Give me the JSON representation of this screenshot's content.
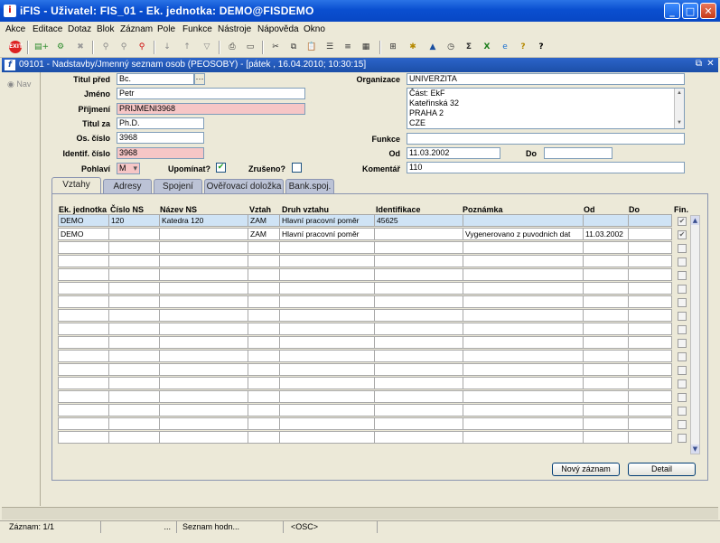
{
  "window": {
    "title": "iFIS - Uživatel: FIS_01 - Ek. jednotka: DEMO@FISDEMO",
    "app_icon": "iFIS-icon",
    "controls": [
      "minimize-icon",
      "maximize-icon",
      "close-icon"
    ]
  },
  "menu": [
    "Akce",
    "Editace",
    "Dotaz",
    "Blok",
    "Záznam",
    "Pole",
    "Funkce",
    "Nástroje",
    "Nápověda",
    "Okno"
  ],
  "toolbar": {
    "icons": [
      "exit-icon",
      "save-icon",
      "insert-record-icon",
      "delete-record-icon",
      "enter-query-icon",
      "execute-query-icon",
      "cancel-query-icon",
      "sort-asc-icon",
      "sort-desc-icon",
      "filter-icon",
      "print-icon",
      "print-preview-icon",
      "cut-icon",
      "copy-icon",
      "paste-icon",
      "list-values-icon",
      "edit-field-icon",
      "calculator-icon",
      "attachment-icon",
      "pin-icon",
      "chart-icon",
      "clock-icon",
      "sum-icon",
      "excel-icon",
      "browser-icon",
      "help-icon",
      "context-help-icon"
    ]
  },
  "form_window": {
    "title": "09101 - Nadstavby/Jmenný seznam osob (PEOSOBY) - [pátek , 16.04.2010; 10:30:15]"
  },
  "left_panel": {
    "nav_label": "Nav"
  },
  "fields": {
    "titul_pred": {
      "label": "Titul před",
      "value": "Bc."
    },
    "jmeno": {
      "label": "Jméno",
      "value": "Petr"
    },
    "prijmeni": {
      "label": "Příjmení",
      "value": "PRIJMENI3968"
    },
    "titul_za": {
      "label": "Titul za",
      "value": "Ph.D."
    },
    "os_cislo": {
      "label": "Os. číslo",
      "value": "3968"
    },
    "identif_cislo": {
      "label": "Identif. číslo",
      "value": "3968"
    },
    "pohlavi": {
      "label": "Pohlaví",
      "value": "M"
    },
    "upominat": {
      "label": "Upomínat?",
      "checked": true
    },
    "zruseno": {
      "label": "Zrušeno?",
      "checked": false
    },
    "organizace": {
      "label": "Organizace",
      "value": "UNIVERZITA"
    },
    "adresa": {
      "lines": [
        "Část: EkF",
        "Kateřinská 32",
        "PRAHA 2",
        "CZE"
      ]
    },
    "funkce": {
      "label": "Funkce",
      "value": ""
    },
    "od": {
      "label": "Od",
      "value": "11.03.2002"
    },
    "do": {
      "label": "Do",
      "value": ""
    },
    "komentar": {
      "label": "Komentář",
      "value": "110"
    }
  },
  "tabs": [
    {
      "label": "Vztahy",
      "active": true
    },
    {
      "label": "Adresy",
      "active": false
    },
    {
      "label": "Spojení",
      "active": false
    },
    {
      "label": "Ověřovací doložka",
      "active": false
    },
    {
      "label": "Bank.spoj.",
      "active": false
    }
  ],
  "table": {
    "columns": [
      "Ek. jednotka",
      "Číslo NS",
      "Název NS",
      "Vztah",
      "Druh vztahu",
      "Identifikace",
      "Poznámka",
      "Od",
      "Do",
      "Fin."
    ],
    "rows": [
      {
        "ek_jednotka": "DEMO",
        "cislo_ns": "120",
        "nazev_ns": "Katedra 120",
        "vztah": "ZAM",
        "druh_vztahu": "Hlavní pracovní poměr",
        "identifikace": "45625",
        "poznamka": "",
        "od": "",
        "do": "",
        "fin": true
      },
      {
        "ek_jednotka": "DEMO",
        "cislo_ns": "",
        "nazev_ns": "",
        "vztah": "ZAM",
        "druh_vztahu": "Hlavní pracovní poměr",
        "identifikace": "",
        "poznamka": "Vygenerovano z puvodnich dat",
        "od": "11.03.2002",
        "do": "",
        "fin": true
      }
    ],
    "empty_rows": 15
  },
  "buttons": {
    "new_record": "Nový záznam",
    "detail": "Detail"
  },
  "status_bar": {
    "record": "Záznam: 1/1",
    "dots": "...",
    "hint": "Seznam hodn...",
    "mode": "<OSC>"
  }
}
